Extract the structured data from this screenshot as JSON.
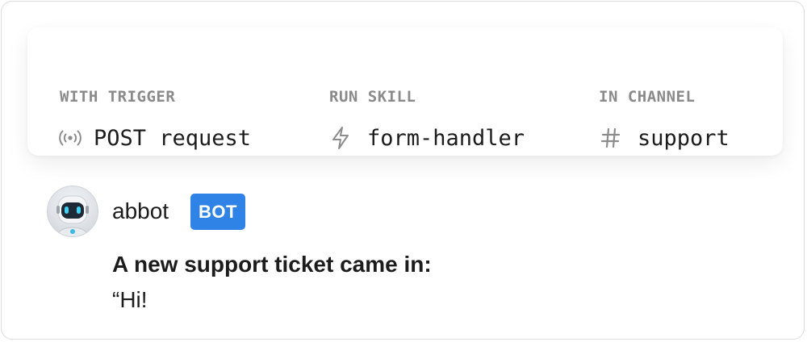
{
  "trigger_card": {
    "columns": [
      {
        "label": "WITH TRIGGER",
        "icon": "broadcast-icon",
        "value": "POST request"
      },
      {
        "label": "RUN SKILL",
        "icon": "lightning-icon",
        "value": "form-handler"
      },
      {
        "label": "IN CHANNEL",
        "icon": "hash-icon",
        "value": "support"
      }
    ]
  },
  "message": {
    "avatar_icon": "robot-avatar-icon",
    "username": "abbot",
    "badge": "BOT",
    "lines": [
      "A new support ticket came in:",
      "“Hi!"
    ]
  },
  "colors": {
    "badge_bg": "#2f83e6",
    "label_gray": "#8a8a8a",
    "text": "#1d1c1d"
  }
}
